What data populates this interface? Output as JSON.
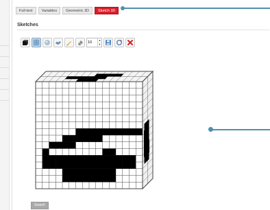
{
  "tabs": [
    {
      "label": "Full-text"
    },
    {
      "label": "Variables"
    },
    {
      "label": "Geometric 3D"
    },
    {
      "label": "Sketch 3D"
    }
  ],
  "active_tab": "Sketch 3D",
  "section": {
    "title": "Sketches"
  },
  "toolbar": {
    "tools": [
      "cube-icon",
      "grid-icon",
      "sphere-icon",
      "bird-icon",
      "pencil-icon",
      "eraser-icon"
    ],
    "size_value": "10",
    "actions": [
      "save-icon",
      "refresh-icon",
      "close-icon"
    ]
  },
  "sketch": {
    "cube": {
      "front_cols": 16,
      "front_rows": 16,
      "depth": 2
    },
    "colors": {
      "filled": "#000000",
      "line": "#444444",
      "cell": "#ffffff",
      "top_fill": "#f4f4f4",
      "side_fill": "#f0f0f0"
    }
  },
  "search": {
    "label": "Search"
  },
  "colors": {
    "active_tab": "#d81e2b",
    "accent_line": "#4f8fb0",
    "delete": "#d82020"
  }
}
